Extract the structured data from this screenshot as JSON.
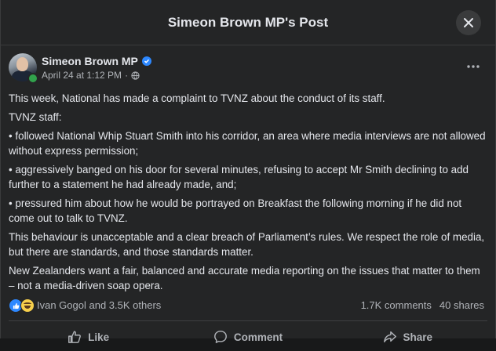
{
  "header": {
    "title": "Simeon Brown MP's Post"
  },
  "post": {
    "author": "Simeon Brown MP",
    "timestamp": "April 24 at 1:12 PM",
    "separator": "·",
    "paragraphs": [
      "This week, National has made a complaint to TVNZ about the conduct of its staff.",
      "TVNZ staff:",
      "• followed National Whip Stuart Smith into his corridor, an area where media interviews are not allowed without express permission;",
      "• aggressively banged on his door for several minutes, refusing to accept Mr Smith declining to add further to a statement he had already made, and;",
      "• pressured him about how he would be portrayed on Breakfast the following morning if he did not come out to talk to TVNZ.",
      "This behaviour is unacceptable and a clear breach of Parliament’s rules. We respect the role of media, but there are standards, and those standards matter.",
      "New Zealanders want a fair, balanced and accurate media reporting on the issues that matter to them – not a media-driven soap opera."
    ]
  },
  "reactions": {
    "summary": "Ivan Gogol and 3.5K others",
    "comments": "1.7K comments",
    "shares": "40 shares"
  },
  "actions": {
    "like": "Like",
    "comment": "Comment",
    "share": "Share"
  },
  "colors": {
    "background": "#242526",
    "text": "#e4e6eb",
    "secondary_text": "#b0b3b8",
    "accent": "#2d88ff",
    "online": "#31a24c"
  }
}
